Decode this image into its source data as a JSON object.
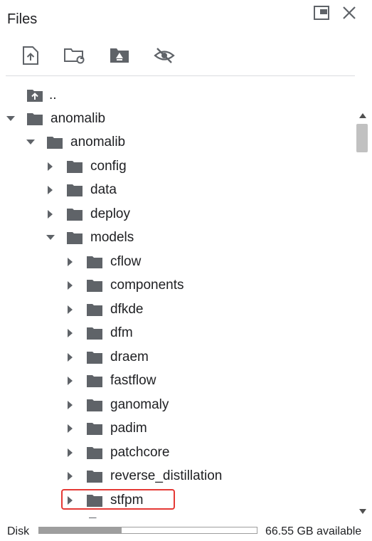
{
  "header": {
    "title": "Files"
  },
  "toolbar": {
    "buttons": [
      {
        "icon": "upload-file-icon"
      },
      {
        "icon": "refresh-folder-icon"
      },
      {
        "icon": "mount-drive-icon"
      },
      {
        "icon": "hide-hidden-files-icon"
      }
    ]
  },
  "tree": {
    "parent": "..",
    "items": [
      {
        "label": "anomalib",
        "depth": 0,
        "expanded": true
      },
      {
        "label": "anomalib",
        "depth": 1,
        "expanded": true
      },
      {
        "label": "config",
        "depth": 2,
        "expanded": false
      },
      {
        "label": "data",
        "depth": 2,
        "expanded": false
      },
      {
        "label": "deploy",
        "depth": 2,
        "expanded": false
      },
      {
        "label": "models",
        "depth": 2,
        "expanded": true
      },
      {
        "label": "cflow",
        "depth": 3,
        "expanded": false
      },
      {
        "label": "components",
        "depth": 3,
        "expanded": false
      },
      {
        "label": "dfkde",
        "depth": 3,
        "expanded": false
      },
      {
        "label": "dfm",
        "depth": 3,
        "expanded": false
      },
      {
        "label": "draem",
        "depth": 3,
        "expanded": false
      },
      {
        "label": "fastflow",
        "depth": 3,
        "expanded": false
      },
      {
        "label": "ganomaly",
        "depth": 3,
        "expanded": false
      },
      {
        "label": "padim",
        "depth": 3,
        "expanded": false
      },
      {
        "label": "patchcore",
        "depth": 3,
        "expanded": false
      },
      {
        "label": "reverse_distillation",
        "depth": 3,
        "expanded": false
      },
      {
        "label": "stfpm",
        "depth": 3,
        "expanded": false
      }
    ]
  },
  "footer": {
    "disk_label": "Disk",
    "disk_used_fraction": 0.38,
    "available": "66.55 GB available"
  },
  "colors": {
    "text": "#202124",
    "icon": "#5f6368",
    "highlight": "#e53935"
  }
}
